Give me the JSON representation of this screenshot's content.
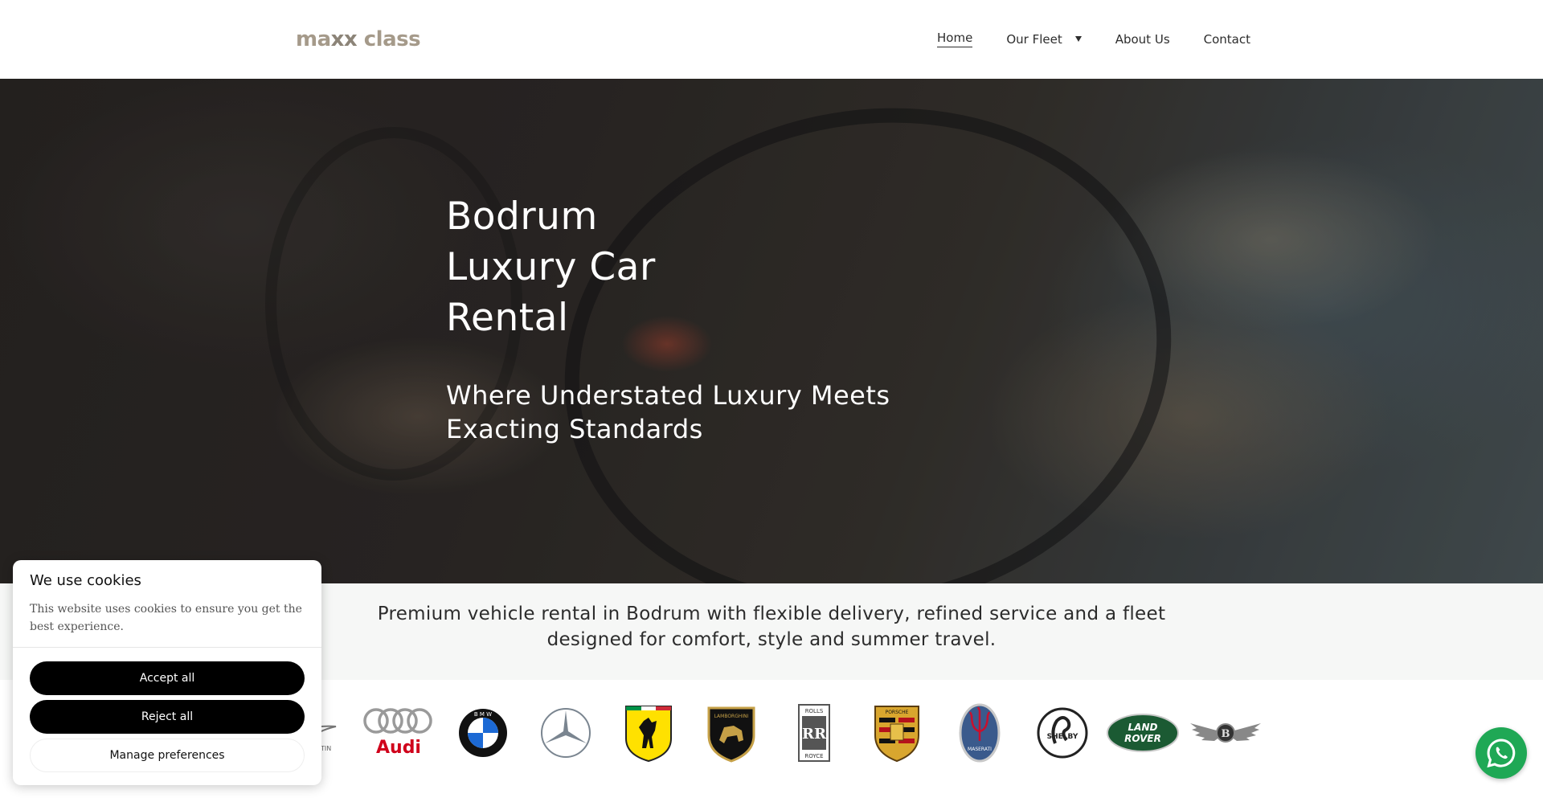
{
  "header": {
    "logo": {
      "part1": "ma",
      "xx": "xx",
      "part2": " class"
    },
    "nav": [
      {
        "label": "Home",
        "active": true
      },
      {
        "label": "Our Fleet",
        "has_dropdown": true
      },
      {
        "label": "About Us"
      },
      {
        "label": "Contact"
      }
    ]
  },
  "hero": {
    "title_lines": [
      "Bodrum",
      "Luxury Car",
      "Rental"
    ],
    "subtitle_lines": [
      "Where Understated Luxury Meets",
      "Exacting Standards"
    ]
  },
  "intro": {
    "line1": "Premium vehicle rental in Bodrum with flexible delivery, refined service and a fleet",
    "line2": "designed for comfort, style and summer travel."
  },
  "brands": {
    "aston_partial": "RTIN",
    "audi": "Audi",
    "bmw": "B M W",
    "lamborghini": "LAMBORGHINI",
    "rolls_top": "ROLLS",
    "rolls_mid": "RR",
    "rolls_bottom": "ROYCE",
    "porsche": "PORSCHE",
    "maserati": "MASERATI",
    "shelby": "SHELBY",
    "land_rover_1": "LAND",
    "land_rover_2": "ROVER",
    "bentley": "B"
  },
  "cookie": {
    "title": "We use cookies",
    "description": "This website uses cookies to ensure you get the best experience.",
    "accept": "Accept all",
    "reject": "Reject all",
    "manage": "Manage preferences"
  },
  "colors": {
    "logo": "#a59a8a",
    "whatsapp": "#1fa855",
    "intro_bg": "#f6f7f6",
    "button_dark": "#000000"
  }
}
